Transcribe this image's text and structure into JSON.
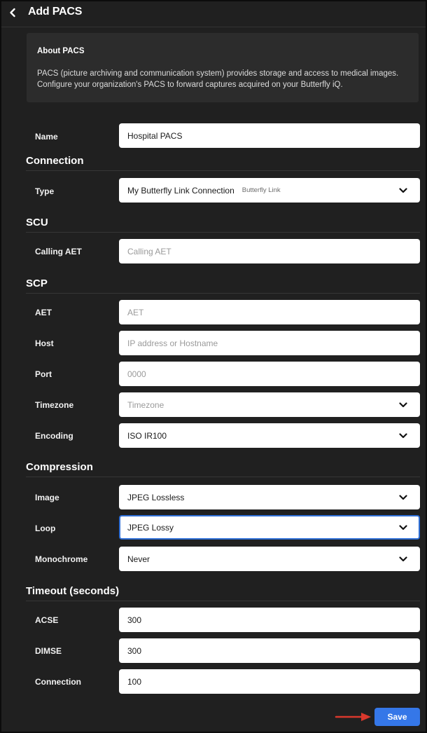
{
  "header": {
    "title": "Add PACS"
  },
  "about": {
    "title": "About PACS",
    "description": "PACS (picture archiving and communication system) provides storage and access to medical images. Configure your organization's PACS to forward captures acquired on your Butterfly iQ."
  },
  "general": {
    "name_label": "Name",
    "name_value": "Hospital PACS"
  },
  "connection": {
    "title": "Connection",
    "type_label": "Type",
    "type_value": "My Butterfly Link Connection",
    "type_tag": "Butterfly Link"
  },
  "scu": {
    "title": "SCU",
    "calling_aet_label": "Calling AET",
    "calling_aet_placeholder": "Calling AET"
  },
  "scp": {
    "title": "SCP",
    "aet_label": "AET",
    "aet_placeholder": "AET",
    "host_label": "Host",
    "host_placeholder": "IP address or Hostname",
    "port_label": "Port",
    "port_placeholder": "0000",
    "timezone_label": "Timezone",
    "timezone_placeholder": "Timezone",
    "encoding_label": "Encoding",
    "encoding_value": "ISO IR100"
  },
  "compression": {
    "title": "Compression",
    "image_label": "Image",
    "image_value": "JPEG Lossless",
    "loop_label": "Loop",
    "loop_value": "JPEG Lossy",
    "monochrome_label": "Monochrome",
    "monochrome_value": "Never"
  },
  "timeout": {
    "title": "Timeout (seconds)",
    "acse_label": "ACSE",
    "acse_value": "300",
    "dimse_label": "DIMSE",
    "dimse_value": "300",
    "connection_label": "Connection",
    "connection_value": "100"
  },
  "actions": {
    "save_label": "Save"
  },
  "colors": {
    "background": "#202020",
    "card": "#2c2c2c",
    "accent": "#3577e8",
    "focus_border": "#2f6fd6",
    "annotation_arrow": "#d9382c"
  },
  "icons": {
    "back": "chevron-left-icon",
    "dropdown": "chevron-down-icon",
    "annotation": "red-arrow-icon"
  }
}
